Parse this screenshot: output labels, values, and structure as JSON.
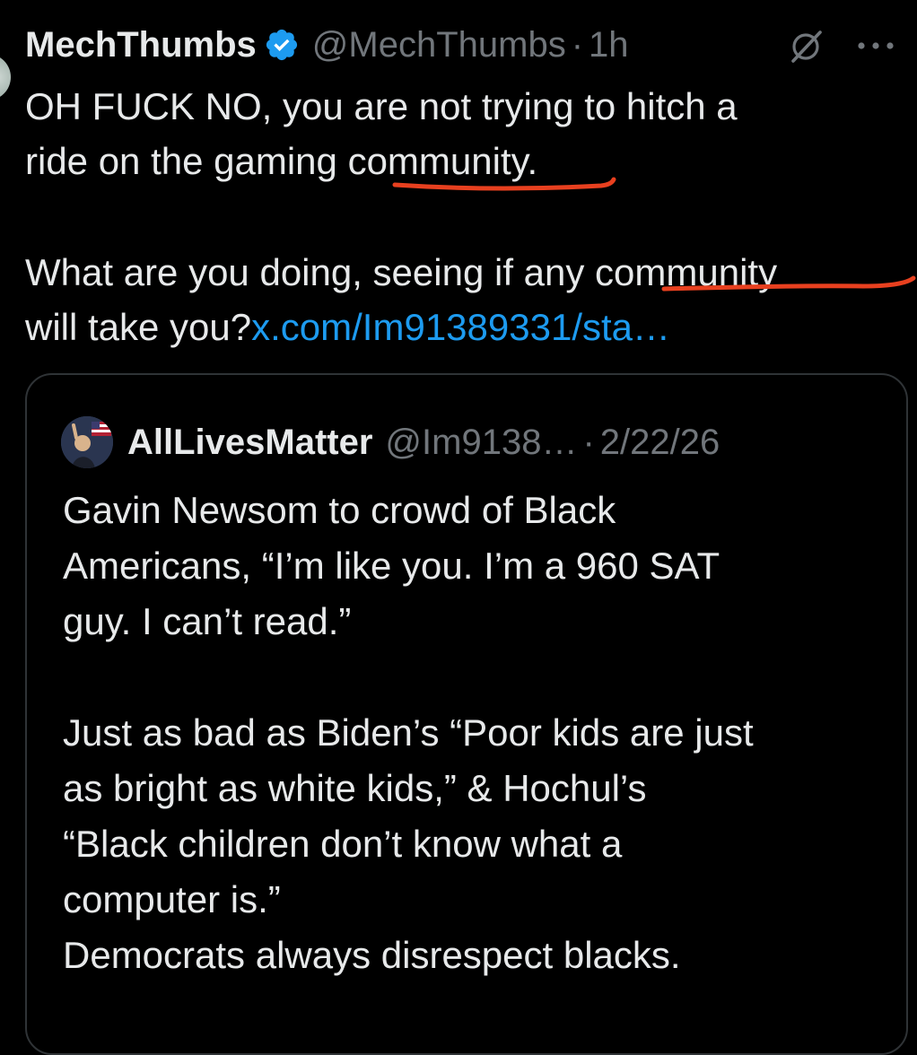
{
  "tweet": {
    "author": {
      "display_name": "MechThumbs",
      "handle": "@MechThumbs",
      "verified": true
    },
    "time": "1h",
    "separator": "·",
    "text": {
      "line1": "OH FUCK NO, you are not trying to hitch a",
      "line2": "ride on the gaming community.",
      "para2_line1": "What are you doing, seeing if any community",
      "para2_line2_prefix": "will take you?",
      "link": "x.com/Im91389331/sta…"
    },
    "icons": {
      "verified": "verified-badge-icon",
      "grok": "grok-icon",
      "more": "more-options-icon"
    }
  },
  "quote": {
    "author": {
      "display_name": "AllLivesMatter",
      "handle": "@Im9138…"
    },
    "separator": "·",
    "date": "2/22/26",
    "text": {
      "l1": "Gavin Newsom to crowd of Black",
      "l2": "Americans, “I’m like you. I’m a 960 SAT",
      "l3": "guy. I can’t read.”",
      "l4": "Just as bad as Biden’s “Poor kids are just",
      "l5": "as bright as white kids,” & Hochul’s",
      "l6": "“Black children don’t know what a",
      "l7": "computer is.”",
      "l8": "Democrats always disrespect blacks."
    }
  },
  "colors": {
    "background": "#000000",
    "text_primary": "#e7e9ea",
    "text_secondary": "#71767b",
    "link": "#1d9bf0",
    "verified": "#1d9bf0",
    "annotation_underline": "#e8401f",
    "card_border": "#2f3336"
  }
}
